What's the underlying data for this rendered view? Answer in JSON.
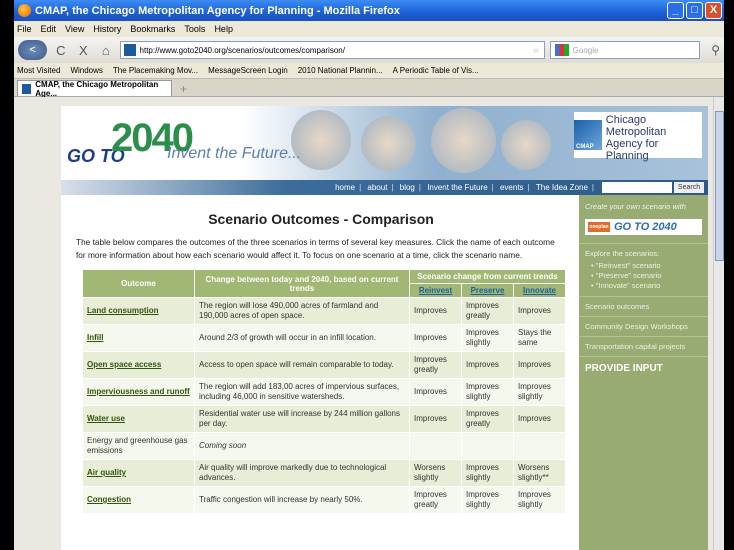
{
  "window": {
    "title": "CMAP, the Chicago Metropolitan Agency for Planning - Mozilla Firefox",
    "buttons": [
      "_",
      "□",
      "X"
    ]
  },
  "menu": [
    "File",
    "Edit",
    "View",
    "History",
    "Bookmarks",
    "Tools",
    "Help"
  ],
  "nav": {
    "back": "<",
    "reload": "C",
    "stop": "X",
    "home": "⌂"
  },
  "url": "http://www.goto2040.org/scenarios/outcomes/comparison/",
  "search_placeholder": "Google",
  "bookmarks": [
    "Most Visited",
    "Windows",
    "The Placemaking Mov...",
    "MessageScreen Login",
    "2010 National Plannin...",
    "A Periodic Table of Vis..."
  ],
  "tab": {
    "label": "CMAP, the Chicago Metropolitan Age...",
    "new": "+"
  },
  "banner": {
    "go": "GO TO",
    "num": "2040",
    "tagline": "Invent the Future...",
    "cmap_line1": "Chicago Metropolitan",
    "cmap_line2": "Agency for Planning",
    "cmap_mark": "CMAP"
  },
  "topnav": {
    "items": [
      "home",
      "about",
      "blog",
      "Invent the Future",
      "events",
      "The Idea Zone"
    ],
    "search_button": "Search"
  },
  "content": {
    "title": "Scenario Outcomes - Comparison",
    "intro": "The table below compares the outcomes of the three scenarios in terms of several key measures.  Click the name of each outcome for more information about how each scenario would affect it. To focus on one scenario at a time, click the scenario name.",
    "headers": {
      "outcome": "Outcome",
      "change": "Change between today and 2040, based on current trends",
      "scenario": "Scenario change from current trends",
      "reinvest": "Reinvest",
      "preserve": "Preserve",
      "innovate": "Innovate"
    },
    "rows": [
      {
        "outcome": "Land consumption",
        "change": "The region will lose 490,000 acres of farmland and 190,000 acres of open space.",
        "reinvest": "Improves",
        "preserve": "Improves greatly",
        "innovate": "Improves"
      },
      {
        "outcome": "Infill",
        "change": "Around 2/3 of growth will occur in an infill location.",
        "reinvest": "Improves",
        "preserve": "Improves slightly",
        "innovate": "Stays the same"
      },
      {
        "outcome": "Open space access",
        "change": "Access to open space will remain comparable to today.",
        "reinvest": "Improves greatly",
        "preserve": "Improves",
        "innovate": "Improves"
      },
      {
        "outcome": "Imperviousness and runoff",
        "change": "The region will add 183,00 acres of impervious surfaces, including 46,000 in sensitive watersheds.",
        "reinvest": "Improves",
        "preserve": "Improves slightly",
        "innovate": "Improves slightly"
      },
      {
        "outcome": "Water use",
        "change": "Residential water use will increase by 244 million gallons per day.",
        "reinvest": "Improves",
        "preserve": "Improves greatly",
        "innovate": "Improves"
      },
      {
        "outcome": "Energy and greenhouse gas emissions",
        "change": "Coming soon",
        "reinvest": "",
        "preserve": "",
        "innovate": ""
      },
      {
        "outcome": "Air quality",
        "change": "Air quality will improve markedly due to technological advances.",
        "reinvest": "Worsens slightly",
        "preserve": "Improves slightly",
        "innovate": "Worsens slightly**"
      },
      {
        "outcome": "Congestion",
        "change": "Traffic congestion will increase by nearly 50%.",
        "reinvest": "Improves greatly",
        "preserve": "Improves slightly",
        "innovate": "Improves slightly"
      }
    ]
  },
  "sidebar": {
    "create": "Create your own scenario with",
    "go_badge": "GO TO 2040",
    "badge_mark": "oneplan",
    "explore": "Explore the scenarios:",
    "scenarios": [
      "\"Reinvest\" scenario",
      "\"Preserve\" scenario",
      "\"Innovate\" scenario"
    ],
    "links": [
      "Scenario outcomes",
      "Community Design Workshops",
      "Transportation capital projects"
    ],
    "provide": "PROVIDE INPUT"
  },
  "colors": {
    "table_header": "#a1b874",
    "sidebar": "#97ab72",
    "title_bar": "#1a5fd6"
  }
}
